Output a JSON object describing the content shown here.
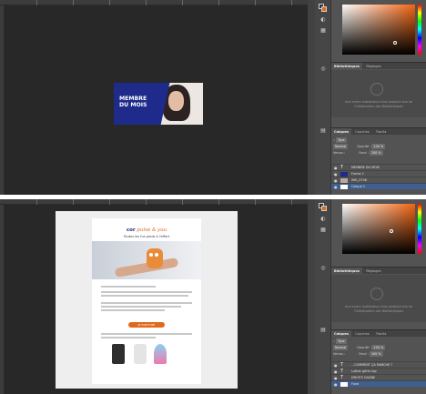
{
  "panels": {
    "tabs_library": [
      "Bibliothèques",
      "Réglages"
    ],
    "tabs_layers": [
      "Calques",
      "Couches",
      "Tracés"
    ],
    "library_message": "Une erreur inattendue s'est produite lors de l'initialisation des Bibliothèques",
    "kind_filter": "Type",
    "blend_mode": "Normal",
    "opacity_label": "Opacité :",
    "opacity_value": "100 %",
    "lock_label": "Verrou :",
    "fill_label": "Fond :",
    "fill_value": "100 %"
  },
  "top_window": {
    "artboard_text": [
      "MEMBRE",
      "DU MOIS"
    ],
    "layers": [
      {
        "name": "MEMBRE DU MOIS",
        "kind": "text"
      },
      {
        "name": "Forme 1",
        "kind": "shape"
      },
      {
        "name": "IMG_0748",
        "kind": "image"
      },
      {
        "name": "Calque 1",
        "kind": "pixel"
      }
    ]
  },
  "bottom_window": {
    "logo_main": "cor",
    "logo_script": "pulse & you",
    "tagline": "Toutes les fun pieds à l'effort",
    "cta_label": "JE PARTICIPE",
    "layers": [
      {
        "name": "...COMMENT ÇA MARCHE ?",
        "kind": "text"
      },
      {
        "name": "Luther gérer top",
        "kind": "text"
      },
      {
        "name": "DROITS GAGNE",
        "kind": "text"
      },
      {
        "name": "Fond",
        "kind": "pixel"
      }
    ]
  },
  "colors": {
    "artboard_blue": "#1e2b8a",
    "accent_orange": "#e06a1c",
    "selection_blue": "#3f5f93"
  }
}
